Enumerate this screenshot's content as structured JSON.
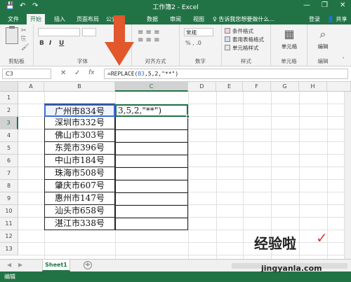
{
  "window": {
    "title": "工作簿2 - Excel"
  },
  "quick_access": {
    "save": "💾",
    "undo": "↶",
    "redo": "↷"
  },
  "window_controls": {
    "minimize": "—",
    "restore": "❐",
    "close": "✕"
  },
  "ribbon_tabs": [
    {
      "label": "文件",
      "active": false
    },
    {
      "label": "开始",
      "active": true
    },
    {
      "label": "插入",
      "active": false
    },
    {
      "label": "页面布局",
      "active": false
    },
    {
      "label": "公式",
      "active": false
    },
    {
      "label": "数据",
      "active": false
    },
    {
      "label": "审阅",
      "active": false
    },
    {
      "label": "视图",
      "active": false
    }
  ],
  "tell_me": "♀ 告诉我您想要做什么...",
  "account": {
    "login": "登录",
    "share": "共享"
  },
  "ribbon": {
    "clipboard_label": "剪贴板",
    "font_label": "字体",
    "alignment_label": "对齐方式",
    "number_label": "数字",
    "number_format": "常规",
    "styles_label": "样式",
    "conditional_format": "条件格式",
    "table_format": "套用表格格式",
    "cell_styles": "单元格样式",
    "cells_label": "单元格",
    "cells_btn": "单元格",
    "editing_label": "编辑",
    "editing_btn": "编辑",
    "bold": "B",
    "italic": "I",
    "underline": "U"
  },
  "formula_bar": {
    "name_box": "C3",
    "cancel": "✕",
    "enter": "✓",
    "fx": "fx",
    "formula_prefix": "=REPLACE(",
    "formula_ref": "B3",
    "formula_suffix": ",5,2,\"**\")"
  },
  "columns": [
    "A",
    "B",
    "C",
    "D",
    "E",
    "F",
    "G",
    "H"
  ],
  "rows": [
    "1",
    "2",
    "3",
    "4",
    "5",
    "6",
    "7",
    "8",
    "9",
    "10",
    "11",
    "12",
    "13"
  ],
  "cells_b": [
    "广州市834号",
    "深圳市332号",
    "佛山市303号",
    "东莞市396号",
    "中山市184号",
    "珠海市508号",
    "肇庆市607号",
    "惠州市147号",
    "汕头市658号",
    "湛江市338号"
  ],
  "editing_cell": {
    "address": "C3",
    "text": "3,5,2,\"**\")"
  },
  "sheet_tabs": [
    {
      "label": "Sheet1",
      "active": true
    }
  ],
  "add_sheet": "+",
  "status": {
    "mode": "编辑"
  },
  "watermark": {
    "line1": "经验啦",
    "check": "✓",
    "line2": "jingyanla.com"
  },
  "colors": {
    "accent": "#217346",
    "arrow": "#e2572c"
  }
}
